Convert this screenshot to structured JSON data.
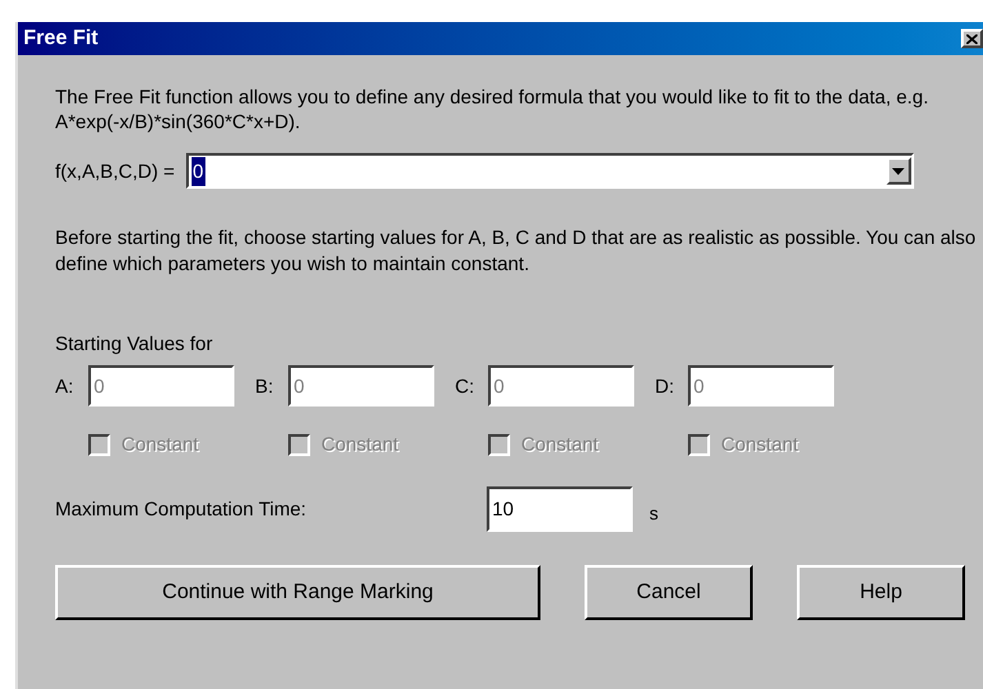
{
  "window": {
    "title": "Free Fit"
  },
  "intro": "The Free Fit function allows you to define any desired formula that you would like to fit to the data, e.g. A*exp(-x/B)*sin(360*C*x+D).",
  "formula": {
    "label": "f(x,A,B,C,D) =",
    "value": "0",
    "text_selected": true
  },
  "instructions": "Before starting the fit, choose starting values for A, B, C and D that are as realistic as possible. You can also define which parameters you wish to maintain constant.",
  "starting_values": {
    "heading": "Starting Values for",
    "parameters": [
      {
        "label": "A:",
        "value": "0",
        "disabled": true,
        "constant": {
          "label": "Constant",
          "checked": false,
          "disabled": true
        }
      },
      {
        "label": "B:",
        "value": "0",
        "disabled": true,
        "constant": {
          "label": "Constant",
          "checked": false,
          "disabled": true
        }
      },
      {
        "label": "C:",
        "value": "0",
        "disabled": true,
        "constant": {
          "label": "Constant",
          "checked": false,
          "disabled": true
        }
      },
      {
        "label": "D:",
        "value": "0",
        "disabled": true,
        "constant": {
          "label": "Constant",
          "checked": false,
          "disabled": true
        }
      }
    ]
  },
  "max_time": {
    "label": "Maximum Computation Time:",
    "value": "10",
    "unit": "s"
  },
  "buttons": [
    "Continue with Range Marking",
    "Cancel",
    "Help"
  ]
}
